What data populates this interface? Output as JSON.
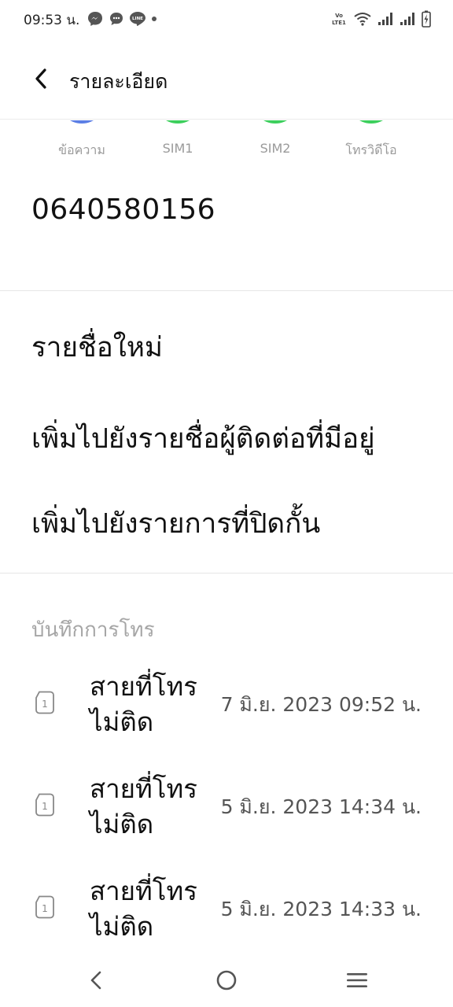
{
  "status_bar": {
    "time": "09:53 น.",
    "volte_label": "Vo LTE1"
  },
  "header": {
    "title": "รายละเอียด"
  },
  "actions": [
    {
      "label": "ข้อความ",
      "color": "#5b7ee5"
    },
    {
      "label": "SIM1",
      "color": "#3ccf5c"
    },
    {
      "label": "SIM2",
      "color": "#3ccf5c"
    },
    {
      "label": "โทรวิดีโอ",
      "color": "#3ccf5c"
    }
  ],
  "contact": {
    "phone_number": "0640580156"
  },
  "options": [
    {
      "label": "รายชื่อใหม่"
    },
    {
      "label": "เพิ่มไปยังรายชื่อผู้ติดต่อที่มีอยู่"
    },
    {
      "label": "เพิ่มไปยังรายการที่ปิดกั้น"
    }
  ],
  "call_log": {
    "title": "บันทึกการโทร",
    "entries": [
      {
        "sim": "1",
        "status": "สายที่โทรไม่ติด",
        "time": "7 มิ.ย. 2023 09:52 น."
      },
      {
        "sim": "1",
        "status": "สายที่โทรไม่ติด",
        "time": "5 มิ.ย. 2023 14:34 น."
      },
      {
        "sim": "1",
        "status": "สายที่โทรไม่ติด",
        "time": "5 มิ.ย. 2023 14:33 น."
      }
    ]
  },
  "nav_bar": {
    "back_icon": "back-triangle-icon",
    "home_icon": "home-circle-icon",
    "menu_icon": "menu-lines-icon"
  }
}
